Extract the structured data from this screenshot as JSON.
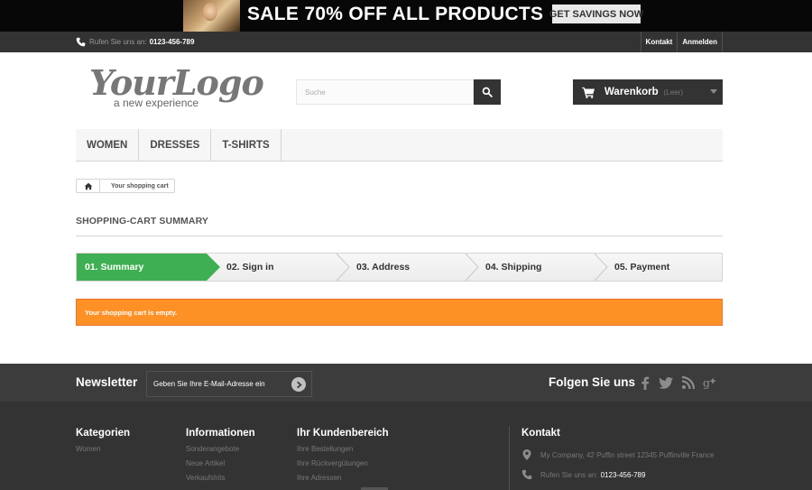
{
  "banner": {
    "headline": "SALE 70% OFF ALL PRODUCTS",
    "cta": "GET SAVINGS NOW"
  },
  "topnav": {
    "phone_prefix": "Rufen Sie uns an:",
    "phone_number": "0123-456-789",
    "links": [
      "Kontakt",
      "Anmelden"
    ]
  },
  "header": {
    "logo_script": "YourLogo",
    "logo_tagline": "a new experience",
    "search_placeholder": "Suche",
    "cart_label": "Warenkorb",
    "cart_status": "(Leer)"
  },
  "menu": [
    "WOMEN",
    "DRESSES",
    "T-SHIRTS"
  ],
  "breadcrumb": {
    "current": "Your shopping cart"
  },
  "page": {
    "title": "SHOPPING-CART SUMMARY"
  },
  "steps": [
    "01. Summary",
    "02. Sign in",
    "03. Address",
    "04. Shipping",
    "05. Payment"
  ],
  "alert": {
    "text": "Your shopping cart is empty."
  },
  "newsletter": {
    "heading": "Newsletter",
    "placeholder": "Geben Sie Ihre E-Mail-Adresse ein"
  },
  "social": {
    "heading": "Folgen Sie uns",
    "icons": [
      "facebook-icon",
      "twitter-icon",
      "rss-icon",
      "google-plus-icon"
    ]
  },
  "footer": {
    "categories": {
      "heading": "Kategorien",
      "items": [
        "Women"
      ]
    },
    "info": {
      "heading": "Informationen",
      "items": [
        "Sonderangebote",
        "Neue Artikel",
        "Verkaufshits"
      ]
    },
    "account": {
      "heading": "Ihr Kundenbereich",
      "items": [
        "Ihre Bestellungen",
        "Ihre Rückvergütungen",
        "Ihre Adressen"
      ]
    },
    "contact": {
      "heading": "Kontakt",
      "address": "My Company, 42 Puffin street 12345 Puffinville France",
      "phone_prefix": "Rufen Sie uns an:",
      "phone_number": "0123-456-789"
    }
  },
  "colors": {
    "accent_green": "#3eaf52",
    "alert_orange": "#fe9126",
    "dark": "#333333"
  }
}
